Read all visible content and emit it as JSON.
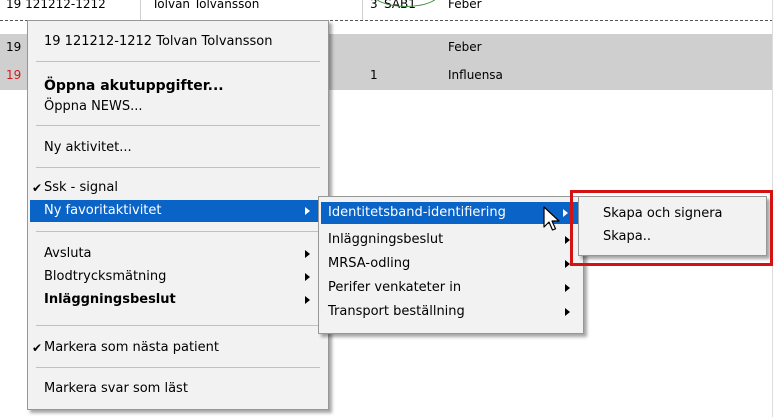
{
  "grid": {
    "rows": [
      {
        "col1": "19  121212-1212",
        "col2": "Tolvan Tolvansson",
        "col3": "3",
        "col4": "SAB1",
        "col5": "Feber"
      },
      {
        "col1": "19",
        "col2": "",
        "col3": "",
        "col4": "",
        "col5": "Feber"
      },
      {
        "col1": "19",
        "col2": "",
        "col3": "1",
        "col4": "",
        "col5": "Influensa"
      }
    ]
  },
  "context_menu": {
    "header": "19  121212-1212 Tolvan Tolvansson",
    "items": [
      {
        "label": "Öppna akutuppgifter...",
        "bold": true
      },
      {
        "label": "Öppna NEWS..."
      },
      {
        "label": "Ny aktivitet..."
      },
      {
        "label": "Ssk - signal",
        "check": "✔"
      },
      {
        "label": "Ny favoritaktivitet"
      },
      {
        "label": "Avsluta"
      },
      {
        "label": "Blodtrycksmätning"
      },
      {
        "label": "Inläggningsbeslut",
        "bold": true
      },
      {
        "label": "Markera som nästa patient",
        "check": "✔"
      },
      {
        "label": "Markera svar som läst"
      }
    ]
  },
  "favorite_submenu": {
    "items": [
      {
        "label": "Identitetsband-identifiering"
      },
      {
        "label": "Inläggningsbeslut"
      },
      {
        "label": "MRSA-odling"
      },
      {
        "label": "Perifer venkateter in"
      },
      {
        "label": "Transport beställning"
      }
    ]
  },
  "identity_submenu": {
    "items": [
      {
        "label": "Skapa och signera"
      },
      {
        "label": "Skapa.."
      }
    ]
  },
  "colors": {
    "highlight": "#0a63c6",
    "menu_bg": "#f2f2f2",
    "red_box": "#d41212"
  }
}
